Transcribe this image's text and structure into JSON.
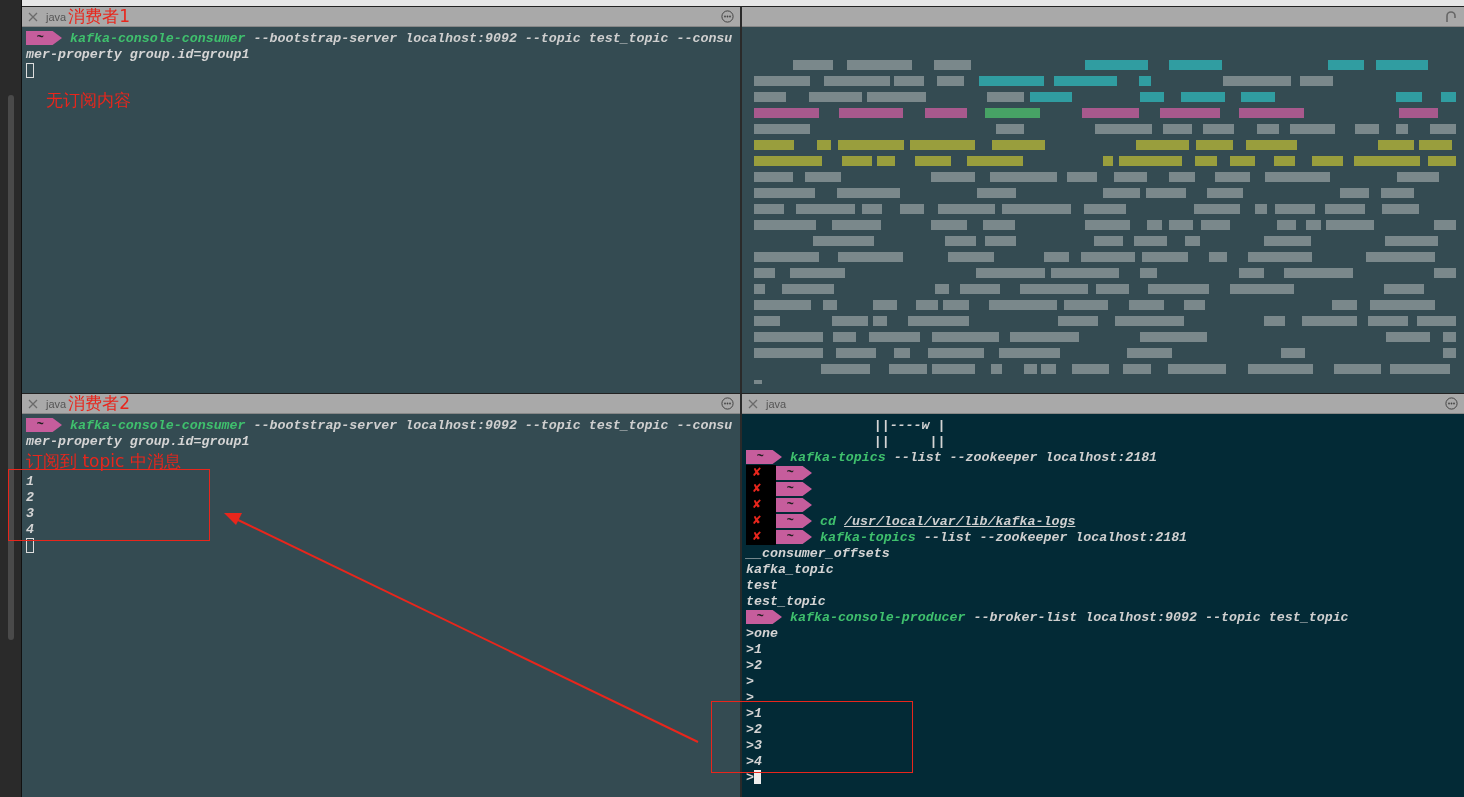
{
  "panes": [
    {
      "title": "java",
      "annotation": "消费者1",
      "kind": "slate",
      "lines": [
        {
          "kind": "prompt",
          "error": false,
          "prompt": "~",
          "command": "kafka-console-consumer",
          "args": "--bootstrap-server localhost:9092 --topic test_topic --consu",
          "underlined": false
        },
        {
          "kind": "text",
          "text": "mer-property group.id=group1"
        },
        {
          "kind": "cursor"
        },
        {
          "kind": "note",
          "text": "无订阅内容"
        }
      ]
    },
    {
      "kind": "blurred"
    },
    {
      "title": "java",
      "annotation": "消费者2",
      "kind": "slate",
      "lines": [
        {
          "kind": "prompt",
          "error": false,
          "prompt": "~",
          "command": "kafka-console-consumer",
          "args": "--bootstrap-server localhost:9092 --topic test_topic --consu",
          "underlined": false
        },
        {
          "kind": "text",
          "text": "mer-property group.id=group1"
        },
        {
          "kind": "note",
          "text": "订阅到 topic 中消息"
        },
        {
          "kind": "boxed",
          "lines": [
            {
              "kind": "text",
              "text": "1"
            },
            {
              "kind": "text",
              "text": "2"
            },
            {
              "kind": "text",
              "text": "3"
            },
            {
              "kind": "text",
              "text": "4"
            }
          ]
        },
        {
          "kind": "cursor"
        }
      ]
    },
    {
      "title": "java",
      "kind": "dark",
      "lines": [
        {
          "kind": "text",
          "text": "                ||----w |"
        },
        {
          "kind": "text",
          "text": "                ||     ||"
        },
        {
          "kind": "prompt",
          "error": false,
          "prompt": "~",
          "command": "kafka-topics",
          "args": "--list --zookeeper localhost:2181",
          "underlined": false
        },
        {
          "kind": "prompt",
          "error": true,
          "mark": "✘",
          "prompt": "~"
        },
        {
          "kind": "prompt",
          "error": true,
          "mark": "✘",
          "prompt": "~"
        },
        {
          "kind": "prompt",
          "error": true,
          "mark": "✘",
          "prompt": "~"
        },
        {
          "kind": "prompt",
          "error": true,
          "mark": "✘",
          "prompt": "~",
          "command": "cd",
          "args": "/usr/local/var/lib/kafka-logs",
          "underlined": true
        },
        {
          "kind": "prompt",
          "error": true,
          "mark": "✘",
          "prompt": "~",
          "command": "kafka-topics",
          "args": "--list --zookeeper localhost:2181",
          "underlined": false
        },
        {
          "kind": "text",
          "text": "__consumer_offsets"
        },
        {
          "kind": "text",
          "text": "kafka_topic"
        },
        {
          "kind": "text",
          "text": "test"
        },
        {
          "kind": "text",
          "text": "test_topic"
        },
        {
          "kind": "prompt",
          "error": false,
          "prompt": "~",
          "command": "kafka-console-producer",
          "args": "--broker-list localhost:9092 --topic test_topic",
          "underlined": false
        },
        {
          "kind": "text",
          "text": ">one"
        },
        {
          "kind": "text",
          "text": ">1"
        },
        {
          "kind": "text",
          "text": ">2"
        },
        {
          "kind": "text",
          "text": ">"
        },
        {
          "kind": "text",
          "text": ">"
        },
        {
          "kind": "boxed",
          "lines": [
            {
              "kind": "text",
              "text": ">1"
            },
            {
              "kind": "text",
              "text": ">2"
            },
            {
              "kind": "text",
              "text": ">3"
            },
            {
              "kind": "text",
              "text": ">4"
            }
          ]
        },
        {
          "kind": "text",
          "text": ">",
          "cursor": true
        }
      ]
    }
  ]
}
